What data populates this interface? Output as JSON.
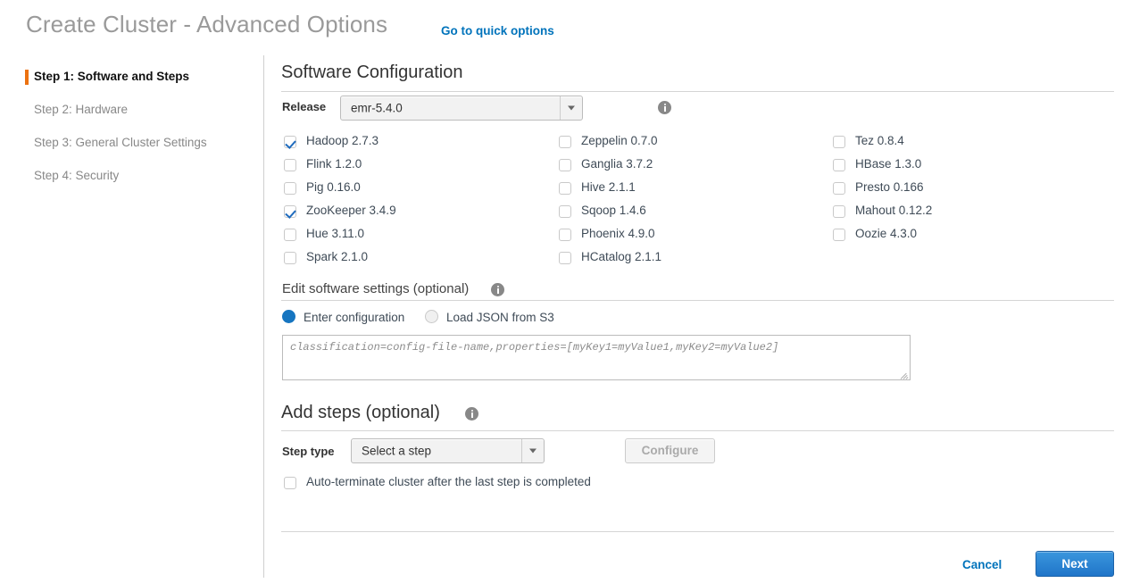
{
  "header": {
    "title": "Create Cluster - Advanced Options",
    "quick_options_link": "Go to quick options"
  },
  "sidebar": {
    "steps": [
      {
        "label": "Step 1: Software and Steps",
        "active": true
      },
      {
        "label": "Step 2: Hardware",
        "active": false
      },
      {
        "label": "Step 3: General Cluster Settings",
        "active": false
      },
      {
        "label": "Step 4: Security",
        "active": false
      }
    ]
  },
  "software_configuration": {
    "heading": "Software Configuration",
    "release_label": "Release",
    "release_value": "emr-5.4.0",
    "info_icon": "info-icon",
    "applications": {
      "column1": [
        {
          "label": "Hadoop 2.7.3",
          "checked": true
        },
        {
          "label": "Flink 1.2.0",
          "checked": false
        },
        {
          "label": "Pig 0.16.0",
          "checked": false
        },
        {
          "label": "ZooKeeper 3.4.9",
          "checked": true
        },
        {
          "label": "Hue 3.11.0",
          "checked": false
        },
        {
          "label": "Spark 2.1.0",
          "checked": false
        }
      ],
      "column2": [
        {
          "label": "Zeppelin 0.7.0",
          "checked": false
        },
        {
          "label": "Ganglia 3.7.2",
          "checked": false
        },
        {
          "label": "Hive 2.1.1",
          "checked": false
        },
        {
          "label": "Sqoop 1.4.6",
          "checked": false
        },
        {
          "label": "Phoenix 4.9.0",
          "checked": false
        },
        {
          "label": "HCatalog 2.1.1",
          "checked": false
        }
      ],
      "column3": [
        {
          "label": "Tez 0.8.4",
          "checked": false
        },
        {
          "label": "HBase 1.3.0",
          "checked": false
        },
        {
          "label": "Presto 0.166",
          "checked": false
        },
        {
          "label": "Mahout 0.12.2",
          "checked": false
        },
        {
          "label": "Oozie 4.3.0",
          "checked": false
        }
      ]
    }
  },
  "edit_software_settings": {
    "heading": "Edit software settings (optional)",
    "options": [
      {
        "label": "Enter configuration",
        "selected": true
      },
      {
        "label": "Load JSON from S3",
        "selected": false
      }
    ],
    "textarea_value": "",
    "textarea_placeholder": "classification=config-file-name,properties=[myKey1=myValue1,myKey2=myValue2]"
  },
  "add_steps": {
    "heading": "Add steps (optional)",
    "step_type_label": "Step type",
    "step_type_value": "Select a step",
    "configure_button": "Configure",
    "auto_terminate": {
      "label": "Auto-terminate cluster after the last step is completed",
      "checked": false
    }
  },
  "footer": {
    "cancel_label": "Cancel",
    "next_label": "Next"
  },
  "colors": {
    "accent_blue": "#0073bb",
    "primary_button": "#2075c9",
    "active_step_marker": "#ec7211",
    "checkbox_check": "#1f6bbd",
    "radio_selected": "#1675c0"
  }
}
